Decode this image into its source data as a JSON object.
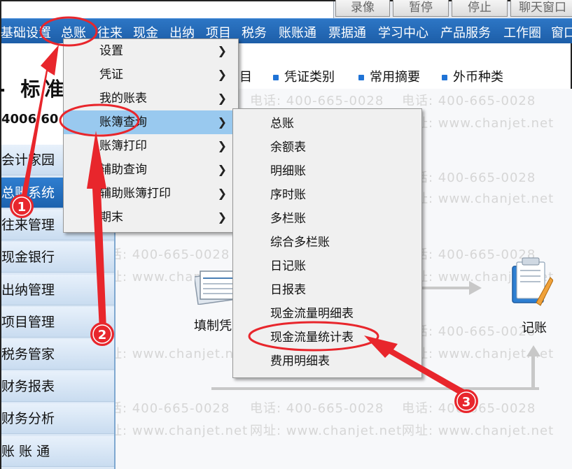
{
  "top_buttons": [
    "录像",
    "暂停",
    "停止",
    "聊天窗口"
  ],
  "menubar": {
    "items": [
      "基础设置",
      "总账",
      "往来",
      "现金",
      "出纳",
      "项目",
      "税务",
      "账账通",
      "票据通",
      "学习中心",
      "产品服务",
      "工作圈",
      "窗口"
    ]
  },
  "header": {
    "title": "- 标准",
    "phone": "4006 60"
  },
  "toolbar": {
    "items": [
      "目",
      "凭证类别",
      "常用摘要",
      "外币种类"
    ]
  },
  "sidebar": {
    "items": [
      "会计家园",
      "总账系统",
      "往来管理",
      "现金银行",
      "出纳管理",
      "项目管理",
      "税务管家",
      "财务报表",
      "财务分析",
      "账 账 通"
    ]
  },
  "menu_level1": {
    "items": [
      {
        "label": "设置",
        "has_submenu": true
      },
      {
        "label": "凭证",
        "has_submenu": true
      },
      {
        "label": "我的账表",
        "has_submenu": true
      },
      {
        "label": "账簿查询",
        "has_submenu": true,
        "highlighted": true
      },
      {
        "label": "账簿打印",
        "has_submenu": true
      },
      {
        "label": "辅助查询",
        "has_submenu": true
      },
      {
        "label": "辅助账簿打印",
        "has_submenu": true
      },
      {
        "label": "期末",
        "has_submenu": true
      }
    ]
  },
  "menu_level2": {
    "items": [
      "总账",
      "余额表",
      "明细账",
      "序时账",
      "多栏账",
      "综合多栏账",
      "日记账",
      "日报表",
      "现金流量明细表",
      "现金流量统计表",
      "费用明细表"
    ]
  },
  "flow": {
    "fill_voucher_label": "填制凭",
    "record_label": "记账"
  },
  "watermark": {
    "phone": "电话: 400-665-0028",
    "url": "网址: www.chanjet.net"
  },
  "annotations": {
    "steps": [
      "1",
      "2",
      "3"
    ],
    "color": "#e8262c"
  },
  "colors": {
    "menubar": "#2468b8",
    "sidebar_active": "#2270c2",
    "menu_highlight": "#99c9ef"
  }
}
